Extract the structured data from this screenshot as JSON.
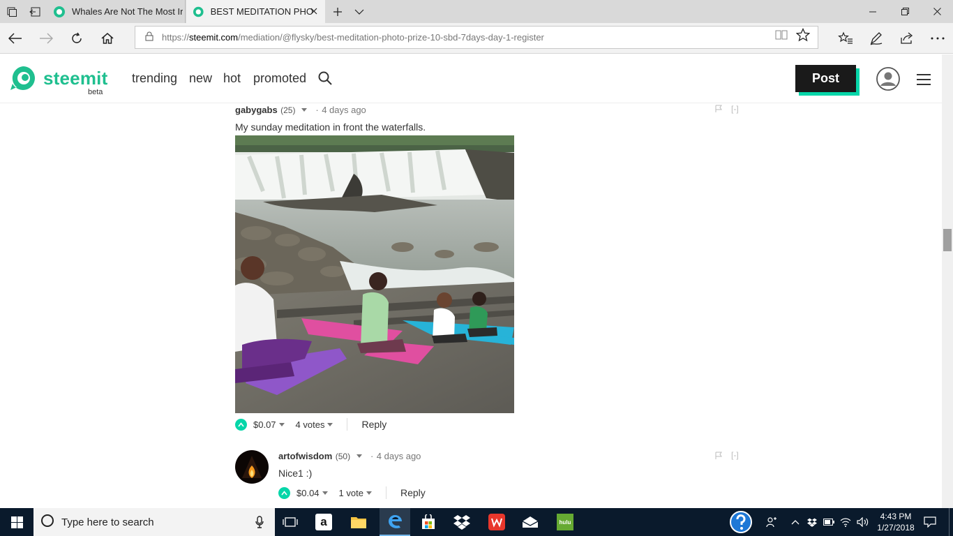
{
  "browser": {
    "tabs": [
      {
        "title": "Whales Are Not The Most Ir",
        "active": false
      },
      {
        "title": "BEST MEDITATION PHO",
        "active": true
      }
    ],
    "url": {
      "scheme": "https://",
      "host": "steemit.com",
      "path": "/mediation/@flysky/best-meditation-photo-prize-10-sbd-7days-day-1-register"
    }
  },
  "site": {
    "logo_text": "steemit",
    "beta_label": "beta",
    "nav": [
      "trending",
      "new",
      "hot",
      "promoted"
    ],
    "post_button": "Post",
    "brand_color": "#06d6a9"
  },
  "comments": [
    {
      "author": "gabygabs",
      "reputation": "(25)",
      "time": "4 days ago",
      "text": "My sunday meditation in front the waterfalls.",
      "payout": "$0.07",
      "votes": "4 votes",
      "reply": "Reply",
      "flag": "[-]"
    },
    {
      "author": "artofwisdom",
      "reputation": "(50)",
      "time": "4 days ago",
      "text": "Nice1 :)",
      "payout": "$0.04",
      "votes": "1 vote",
      "reply": "Reply",
      "flag": "[-]"
    }
  ],
  "taskbar": {
    "search_placeholder": "Type here to search",
    "amazon_glyph": "a",
    "hulu_label": "hulu",
    "time": "4:43 PM",
    "date": "1/27/2018"
  }
}
